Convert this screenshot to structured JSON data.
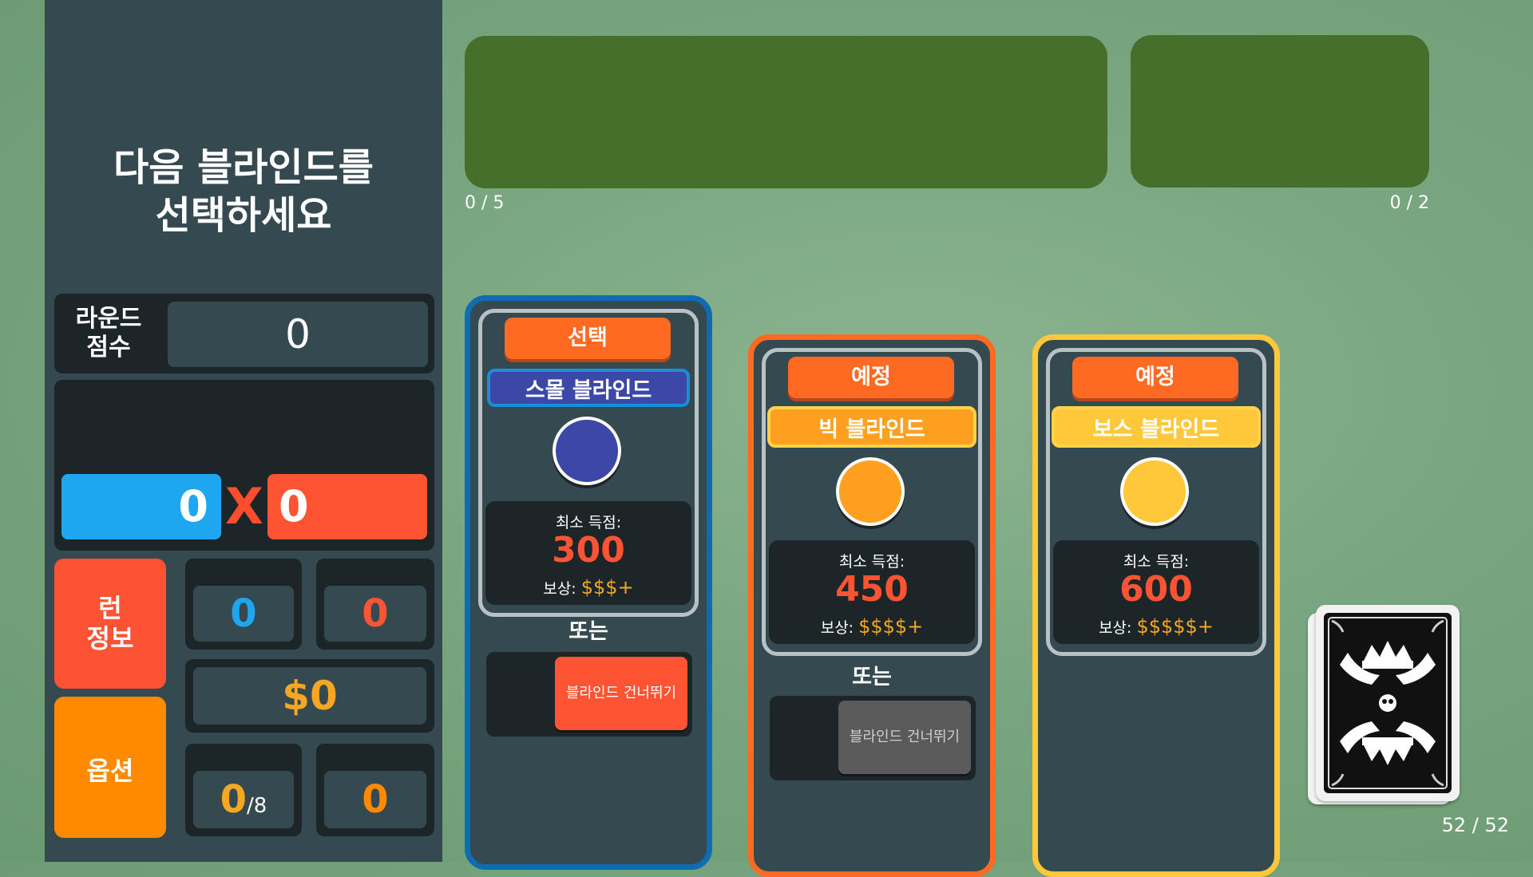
{
  "sidebar": {
    "title_line1": "다음 블라인드를",
    "title_line2": "선택하세요",
    "round_score": {
      "label_line1": "라운드",
      "label_line2": "점수",
      "value": "0"
    },
    "calculation": {
      "chips": "0",
      "x": "X",
      "mult": "0"
    },
    "run_info": {
      "line1": "런",
      "line2": "정보"
    },
    "options": "옵션",
    "hands": "0",
    "discards": "0",
    "money": "$0",
    "ante": {
      "value": "0",
      "max": "/8"
    },
    "round": "0"
  },
  "joker_area": {
    "count": "0 / 5"
  },
  "consumable_area": {
    "count": "0 / 2"
  },
  "blinds": [
    {
      "state": "선택",
      "name": "스몰 블라인드",
      "min_score_label": "최소 득점:",
      "min_score": "300",
      "reward_label": "보상:",
      "reward": "$$$+",
      "or_label": "또는",
      "skip_label": "블라인드 건너뛰기"
    },
    {
      "state": "예정",
      "name": "빅 블라인드",
      "min_score_label": "최소 득점:",
      "min_score": "450",
      "reward_label": "보상:",
      "reward": "$$$$+",
      "or_label": "또는",
      "skip_label": "블라인드 건너뛰기"
    },
    {
      "state": "예정",
      "name": "보스 블라인드",
      "min_score_label": "최소 득점:",
      "min_score": "600",
      "reward_label": "보상:",
      "reward": "$$$$$+"
    }
  ],
  "deck": {
    "count": "52 / 52",
    "icon": "card-back-crown-icon"
  },
  "colors": {
    "sidebar": "#354a50",
    "chips": "#1ea7f0",
    "mult": "#ff5434",
    "small_blind": "#3b48a8",
    "big_blind": "#ffa020",
    "boss_blind": "#ffc83a",
    "table": "#79a680"
  }
}
